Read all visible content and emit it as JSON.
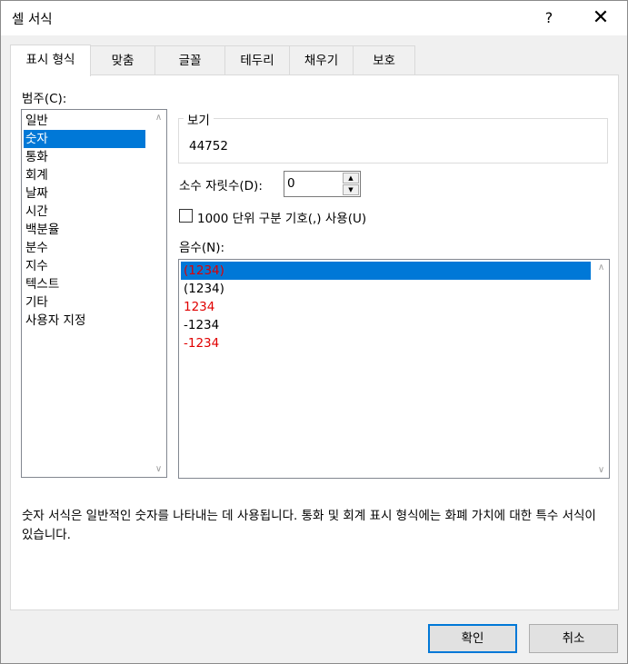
{
  "window": {
    "title": "셀 서식",
    "help": "?",
    "close": "✕"
  },
  "tabs": [
    "표시 형식",
    "맞춤",
    "글꼴",
    "테두리",
    "채우기",
    "보호"
  ],
  "category": {
    "label": "범주(C):",
    "items": [
      "일반",
      "숫자",
      "통화",
      "회계",
      "날짜",
      "시간",
      "백분율",
      "분수",
      "지수",
      "텍스트",
      "기타",
      "사용자 지정"
    ],
    "selected": "숫자"
  },
  "sample": {
    "title": "보기",
    "value": "44752"
  },
  "decimal": {
    "label": "소수 자릿수(D):",
    "value": "0"
  },
  "separator": {
    "label": "1000 단위 구분 기호(,) 사용(U)",
    "checked": false
  },
  "negative": {
    "label": "음수(N):",
    "items": [
      {
        "text": "(1234)",
        "color": "#e00000",
        "selected": true
      },
      {
        "text": "(1234)",
        "color": "#000000",
        "selected": false
      },
      {
        "text": "1234",
        "color": "#e00000",
        "selected": false
      },
      {
        "text": "-1234",
        "color": "#000000",
        "selected": false
      },
      {
        "text": "-1234",
        "color": "#e00000",
        "selected": false
      }
    ]
  },
  "description": "숫자 서식은 일반적인 숫자를 나타내는 데 사용됩니다. 통화 및 회계 표시 형식에는 화폐 가치에 대한 특수 서식이 있습니다.",
  "buttons": {
    "ok": "확인",
    "cancel": "취소"
  }
}
